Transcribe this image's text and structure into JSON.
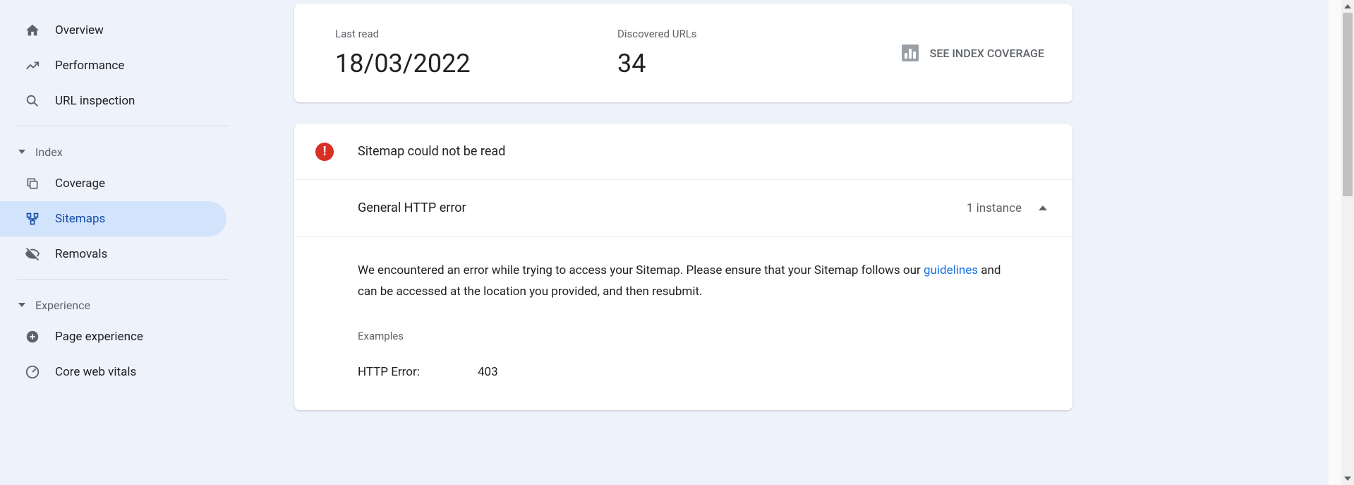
{
  "sidebar": {
    "items": [
      {
        "label": "Overview"
      },
      {
        "label": "Performance"
      },
      {
        "label": "URL inspection"
      }
    ],
    "section_index": "Index",
    "index_items": [
      {
        "label": "Coverage"
      },
      {
        "label": "Sitemaps"
      },
      {
        "label": "Removals"
      }
    ],
    "section_experience": "Experience",
    "experience_items": [
      {
        "label": "Page experience"
      },
      {
        "label": "Core web vitals"
      }
    ]
  },
  "stats": {
    "last_read_label": "Last read",
    "last_read_value": "18/03/2022",
    "discovered_label": "Discovered URLs",
    "discovered_value": "34",
    "see_index_label": "SEE INDEX COVERAGE"
  },
  "error": {
    "title": "Sitemap could not be read",
    "reason_title": "General HTTP error",
    "instance_count": "1 instance",
    "description_pre": "We encountered an error while trying to access your Sitemap. Please ensure that your Sitemap follows our ",
    "guidelines_link": "guidelines",
    "description_post": " and can be accessed at the location you provided, and then resubmit.",
    "examples_label": "Examples",
    "example_key": "HTTP Error:",
    "example_value": "403"
  }
}
